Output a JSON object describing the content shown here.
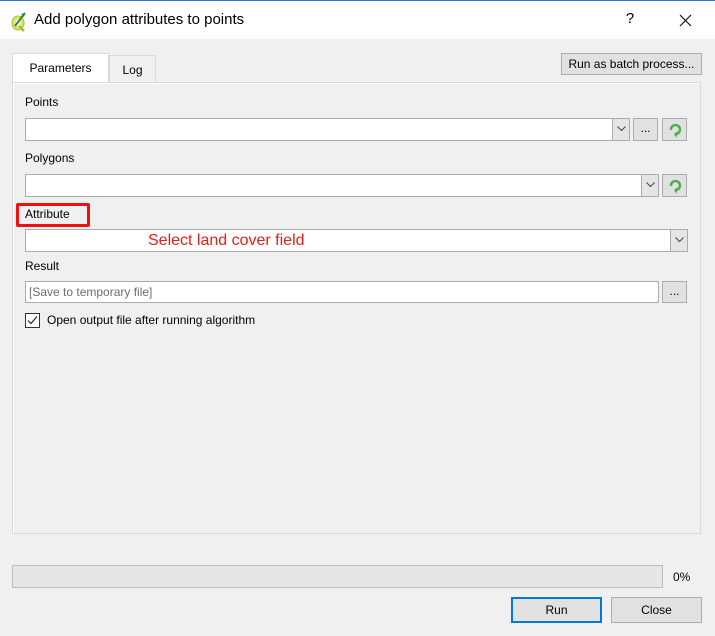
{
  "window": {
    "title": "Add polygon attributes to points",
    "help_label": "?",
    "icons": {
      "app": "qgis-icon",
      "close": "close-icon"
    }
  },
  "tabs": [
    {
      "label": "Parameters",
      "active": true
    },
    {
      "label": "Log",
      "active": false
    }
  ],
  "toolbar": {
    "batch_label": "Run as batch process..."
  },
  "form": {
    "points": {
      "label": "Points",
      "value": "",
      "browse_label": "..."
    },
    "polygons": {
      "label": "Polygons",
      "value": ""
    },
    "attribute": {
      "label": "Attribute",
      "value": ""
    },
    "result": {
      "label": "Result",
      "placeholder": "[Save to temporary file]",
      "browse_label": "..."
    },
    "open_output": {
      "label": "Open output file after running algorithm",
      "checked": true
    }
  },
  "annotation": {
    "text": "Select land cover field",
    "color": "#e0201d"
  },
  "progress": {
    "value": 0,
    "label": "0%"
  },
  "buttons": {
    "run": "Run",
    "close": "Close"
  },
  "colors": {
    "accent": "#0078d7",
    "annotation_box": "#ee1111",
    "refresh_icon": "#4caf50"
  }
}
